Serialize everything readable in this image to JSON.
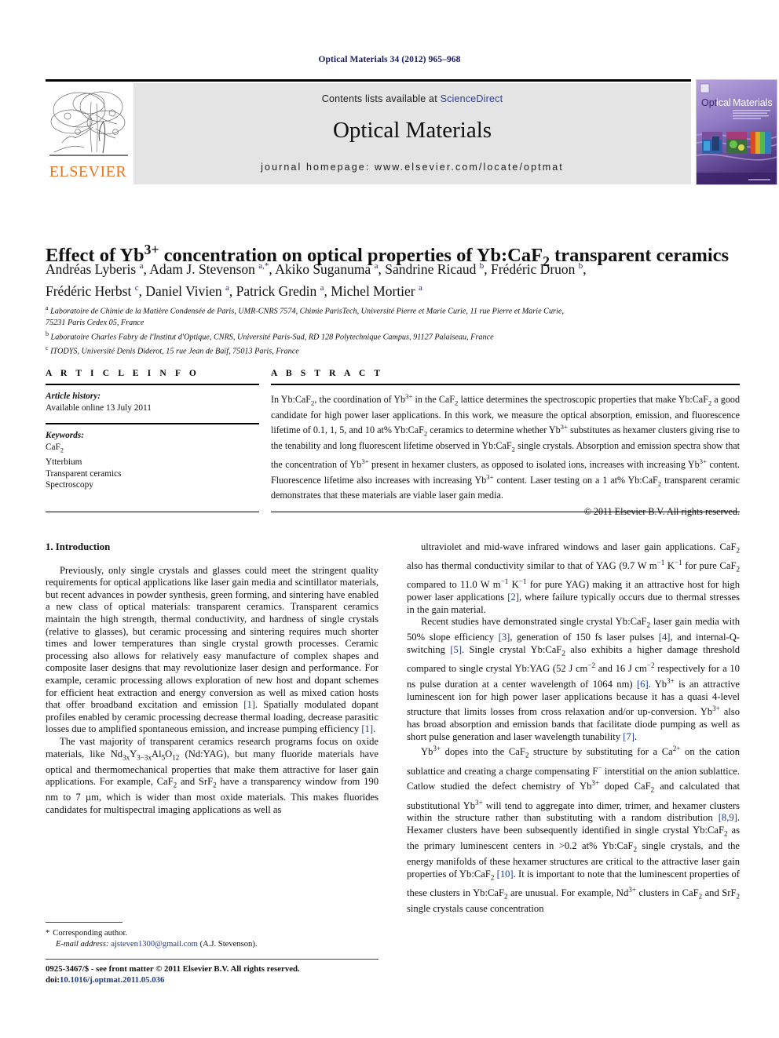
{
  "running_head": "Optical Materials 34 (2012) 965–968",
  "masthead": {
    "contents_prefix": "Contents lists available at",
    "sciencedirect": "ScienceDirect",
    "journal_name": "Optical Materials",
    "homepage": "journal homepage: www.elsevier.com/locate/optmat",
    "publisher_logo_text": "ELSEVIER",
    "cover_title_part1": "Optical",
    "cover_title_part2": "Materials",
    "accent_link_color": "#2a3f9d",
    "elsevier_orange": "#e87722"
  },
  "article": {
    "title_html": "Effect of Yb<sup>3+</sup> concentration on optical properties of Yb:CaF<sub>2</sub> transparent ceramics",
    "authors_html": "Andréas Lyberis <sup class=\"sup-a\">a</sup>, Adam J. Stevenson <sup class=\"sup-a\">a,*</sup>, Akiko Suganuma <sup class=\"sup-a\">a</sup>, Sandrine Ricaud <sup class=\"sup-a\">b</sup>, Frédéric Druon <sup class=\"sup-a\">b</sup>,<br>Frédéric Herbst <sup class=\"sup-a\">c</sup>, Daniel Vivien <sup class=\"sup-a\">a</sup>, Patrick Gredin <sup class=\"sup-a\">a</sup>, Michel Mortier <sup class=\"sup-a\">a</sup>",
    "affiliations_html": "<sup>a</sup> Laboratoire de Chimie de la Matière Condensée de Paris, UMR-CNRS 7574, Chimie ParisTech, Université Pierre et Marie Curie, 11 rue Pierre et Marie Curie,<br>75231 Paris Cedex 05, France<br><sup>b</sup> Laboratoire Charles Fabry de l'Institut d'Optique, CNRS, Université Paris-Sud, RD 128 Polytechnique Campus, 91127 Palaiseau, France<br><sup>c</sup> ITODYS, Université Denis Diderot, 15 rue Jean de Baïf, 75013 Paris, France"
  },
  "article_info": {
    "heading": "A R T I C L E    I N F O",
    "history_label": "Article history:",
    "history_value": "Available online 13 July 2011",
    "keywords_label": "Keywords:",
    "keywords_html": "CaF<sub>2</sub><br>Ytterbium<br>Transparent ceramics<br>Spectroscopy"
  },
  "abstract": {
    "heading": "A B S T R A C T",
    "body_html": "In Yb:CaF<sub>2</sub>, the coordination of Yb<sup>3+</sup> in the CaF<sub>2</sub> lattice determines the spectroscopic properties that make Yb:CaF<sub>2</sub> a good candidate for high power laser applications. In this work, we measure the optical absorption, emission, and fluorescence lifetime of 0.1, 1, 5, and 10 at% Yb:CaF<sub>2</sub> ceramics to determine whether Yb<sup>3+</sup> substitutes as hexamer clusters giving rise to the tenability and long fluorescent lifetime observed in Yb:CaF<sub>2</sub> single crystals. Absorption and emission spectra show that the concentration of Yb<sup>3+</sup> present in hexamer clusters, as opposed to isolated ions, increases with increasing Yb<sup>3+</sup> content. Fluorescence lifetime also increases with increasing Yb<sup>3+</sup> content. Laser testing on a 1 at% Yb:CaF<sub>2</sub> transparent ceramic demonstrates that these materials are viable laser gain media.",
    "copyright": "© 2011 Elsevier B.V. All rights reserved."
  },
  "body": {
    "section_heading": "1. Introduction",
    "left_paragraphs_html": [
      "Previously, only single crystals and glasses could meet the stringent quality requirements for optical applications like laser gain media and scintillator materials, but recent advances in powder synthesis, green forming, and sintering have enabled a new class of optical materials: transparent ceramics. Transparent ceramics maintain the high strength, thermal conductivity, and hardness of single crystals (relative to glasses), but ceramic processing and sintering requires much shorter times and lower temperatures than single crystal growth processes. Ceramic processing also allows for relatively easy manufacture of complex shapes and composite laser designs that may revolutionize laser design and performance. For example, ceramic processing allows exploration of new host and dopant schemes for efficient heat extraction and energy conversion as well as mixed cation hosts that offer broadband excitation and emission <span class=\"ref\">[1]</span>. Spatially modulated dopant profiles enabled by ceramic processing decrease thermal loading, decrease parasitic losses due to amplified spontaneous emission, and increase pumping efficiency <span class=\"ref\">[1]</span>.",
      "The vast majority of transparent ceramics research programs focus on oxide materials, like Nd<sub>3x</sub>Y<sub>3−3x</sub>Al<sub>5</sub>O<sub>12</sub> (Nd:YAG), but many fluoride materials have optical and thermomechanical properties that make them attractive for laser gain applications. For example, CaF<sub>2</sub> and SrF<sub>2</sub> have a transparency window from 190 nm to 7 µm, which is wider than most oxide materials. This makes fluorides candidates for multispectral imaging applications as well as"
    ],
    "right_paragraphs_html": [
      "ultraviolet and mid-wave infrared windows and laser gain applications. CaF<sub>2</sub> also has thermal conductivity similar to that of YAG (9.7 W m<sup>−1</sup> K<sup>−1</sup> for pure CaF<sub>2</sub> compared to 11.0 W m<sup>−1</sup> K<sup>−1</sup> for pure YAG) making it an attractive host for high power laser applications <span class=\"ref\">[2]</span>, where failure typically occurs due to thermal stresses in the gain material.",
      "Recent studies have demonstrated single crystal Yb:CaF<sub>2</sub> laser gain media with 50% slope efficiency <span class=\"ref\">[3]</span>, generation of 150 fs laser pulses <span class=\"ref\">[4]</span>, and internal-Q-switching <span class=\"ref\">[5]</span>. Single crystal Yb:CaF<sub>2</sub> also exhibits a higher damage threshold compared to single crystal Yb:YAG (52 J cm<sup>−2</sup> and 16 J cm<sup>−2</sup> respectively for a 10 ns pulse duration at a center wavelength of 1064 nm) <span class=\"ref\">[6]</span>. Yb<sup>3+</sup> is an attractive luminescent ion for high power laser applications because it has a quasi 4-level structure that limits losses from cross relaxation and/or up-conversion. Yb<sup>3+</sup> also has broad absorption and emission bands that facilitate diode pumping as well as short pulse generation and laser wavelength tunability <span class=\"ref\">[7]</span>.",
      "Yb<sup>3+</sup> dopes into the CaF<sub>2</sub> structure by substituting for a Ca<sup>2+</sup> on the cation sublattice and creating a charge compensating F<sup>−</sup> interstitial on the anion sublattice. Catlow studied the defect chemistry of Yb<sup>3+</sup> doped CaF<sub>2</sub> and calculated that substitutional Yb<sup>3+</sup> will tend to aggregate into dimer, trimer, and hexamer clusters within the structure rather than substituting with a random distribution <span class=\"ref\">[8,9]</span>. Hexamer clusters have been subsequently identified in single crystal Yb:CaF<sub>2</sub> as the primary luminescent centers in &gt;0.2 at% Yb:CaF<sub>2</sub> single crystals, and the energy manifolds of these hexamer structures are critical to the attractive laser gain properties of Yb:CaF<sub>2</sub> <span class=\"ref\">[10]</span>. It is important to note that the luminescent properties of these clusters in Yb:CaF<sub>2</sub> are unusual. For example, Nd<sup>3+</sup> clusters in CaF<sub>2</sub> and SrF<sub>2</sub> single crystals cause concentration"
    ]
  },
  "footnote": {
    "star": "*",
    "corresponding": "Corresponding author.",
    "email_label": "E-mail address:",
    "email": "ajsteven1300@gmail.com",
    "email_owner": "(A.J. Stevenson)."
  },
  "footer": {
    "line1": "0925-3467/$ - see front matter © 2011 Elsevier B.V. All rights reserved.",
    "doi_label": "doi:",
    "doi_value": "10.1016/j.optmat.2011.05.036"
  }
}
